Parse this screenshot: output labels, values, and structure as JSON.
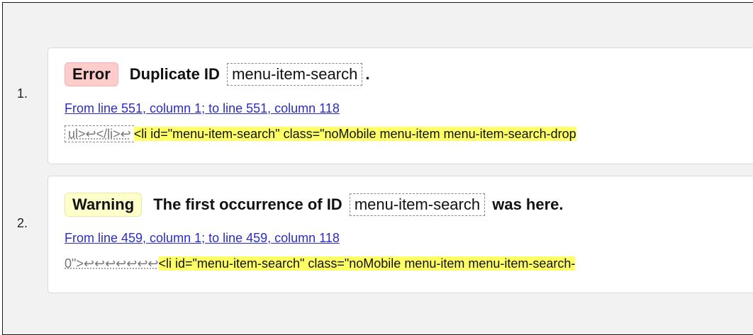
{
  "messages": [
    {
      "number": "1.",
      "badge": "Error",
      "text_before": "Duplicate ID",
      "code": "menu-item-search",
      "text_after": ".",
      "location": "From line 551, column 1; to line 551, column 118",
      "extract_before": "ul>↩</li>↩",
      "extract_highlight": "<li id=\"menu-item-search\" class=\"noMobile menu-item menu-item-search-drop"
    },
    {
      "number": "2.",
      "badge": "Warning",
      "text_before": "The first occurrence of ID",
      "code": "menu-item-search",
      "text_after": "was here.",
      "location": "From line 459, column 1; to line 459, column 118",
      "extract_before": "0\">↩↩↩↩↩↩↩",
      "extract_highlight": "<li id=\"menu-item-search\" class=\"noMobile menu-item menu-item-search-"
    }
  ],
  "colors": {
    "error_badge": "#ffcccc",
    "warning_badge": "#ffffcc",
    "highlight": "#ffff66",
    "link": "#2c2cc8"
  }
}
